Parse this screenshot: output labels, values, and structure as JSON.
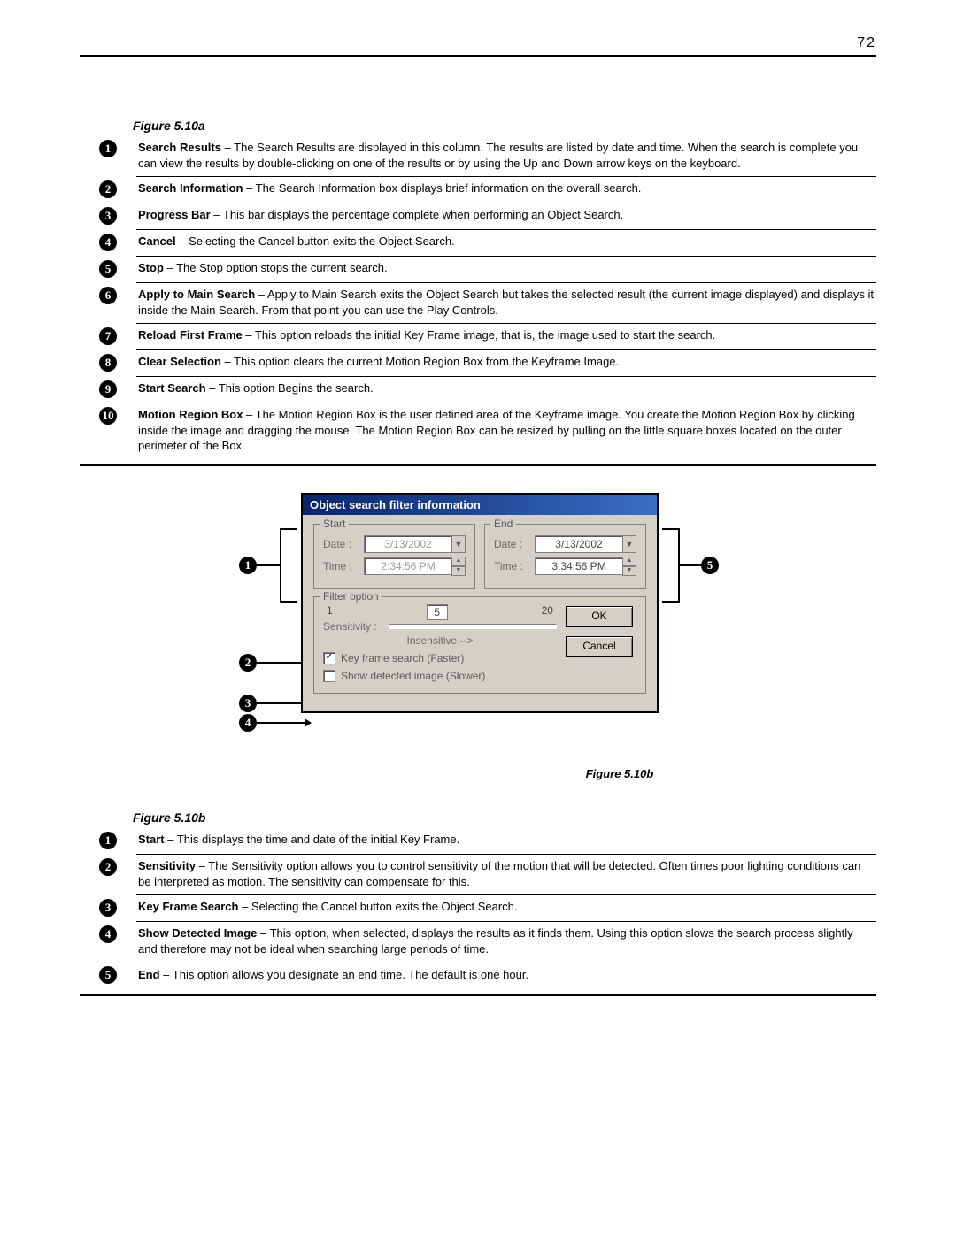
{
  "page_number": "72",
  "figure_a": {
    "title": "Figure 5.10a",
    "items": [
      {
        "n": "1",
        "term": "Search Results",
        "text": " – The Search Results are displayed in this column. The results are listed by date and time. When the search is complete you can view the results by double-clicking on one of the results or by using the Up and Down arrow keys on the keyboard."
      },
      {
        "n": "2",
        "term": "Search Information",
        "text": " – The Search Information box displays brief information on the overall search."
      },
      {
        "n": "3",
        "term": "Progress Bar",
        "text": " – This bar displays the percentage complete when performing an Object Search."
      },
      {
        "n": "4",
        "term": "Cancel",
        "text": " – Selecting the Cancel button exits the Object Search."
      },
      {
        "n": "5",
        "term": "Stop",
        "text": " – The Stop option stops the current search."
      },
      {
        "n": "6",
        "term": "Apply to Main Search",
        "text": " – Apply to Main Search exits the Object Search but takes the selected result (the current image displayed) and displays it inside the Main Search. From that point you can use the Play Controls."
      },
      {
        "n": "7",
        "term": "Reload First Frame",
        "text": " – This option reloads the initial Key Frame image, that is, the image used to start the search."
      },
      {
        "n": "8",
        "term": "Clear Selection",
        "text": " – This option clears the current Motion Region Box from the Keyframe Image."
      },
      {
        "n": "9",
        "term": "Start Search",
        "text": " – This option Begins the search."
      },
      {
        "n": "10",
        "term": "Motion Region Box",
        "text": " – The Motion Region Box is the user defined area of the Keyframe image. You create the Motion Region Box by clicking inside the image and dragging the mouse. The Motion Region Box can be resized by pulling on the little square boxes located on the outer perimeter of the Box."
      }
    ]
  },
  "dialog": {
    "title": "Object search filter information",
    "start": {
      "group": "Start",
      "date_label": "Date :",
      "time_label": "Time :",
      "date": "3/13/2002",
      "time": "2:34:56 PM"
    },
    "end": {
      "group": "End",
      "date_label": "Date :",
      "time_label": "Time :",
      "date": "3/13/2002",
      "time": "3:34:56 PM"
    },
    "filter": {
      "group": "Filter option",
      "sens_label": "Sensitivity :",
      "scale_left": "1",
      "scale_mid": "5",
      "scale_right": "20",
      "insensitive": "Insensitive -->",
      "keyframe": "Key frame search (Faster)",
      "showdet": "Show detected image (Slower)",
      "ok": "OK",
      "cancel": "Cancel"
    },
    "caption": "Figure 5.10b"
  },
  "callout_nums": {
    "c1": "1",
    "c2": "2",
    "c3": "3",
    "c4": "4",
    "c5": "5"
  },
  "figure_b": {
    "title": "Figure 5.10b",
    "items": [
      {
        "n": "1",
        "term": "Start",
        "text": " – This displays the time and date of the initial Key Frame."
      },
      {
        "n": "2",
        "term": "Sensitivity",
        "text": " – The Sensitivity option allows you to control sensitivity of the motion that will be detected. Often times poor lighting conditions can be interpreted as motion. The sensitivity can compensate for this."
      },
      {
        "n": "3",
        "term": "Key Frame Search",
        "text": " – Selecting the Cancel button exits the Object Search."
      },
      {
        "n": "4",
        "term": "Show Detected Image",
        "text": " – This option, when selected, displays the results as it finds them. Using this option slows the search process slightly and therefore may not be ideal when searching large periods of time."
      },
      {
        "n": "5",
        "term": "End",
        "text": " – This option allows you designate an end time. The default is one hour."
      }
    ]
  }
}
